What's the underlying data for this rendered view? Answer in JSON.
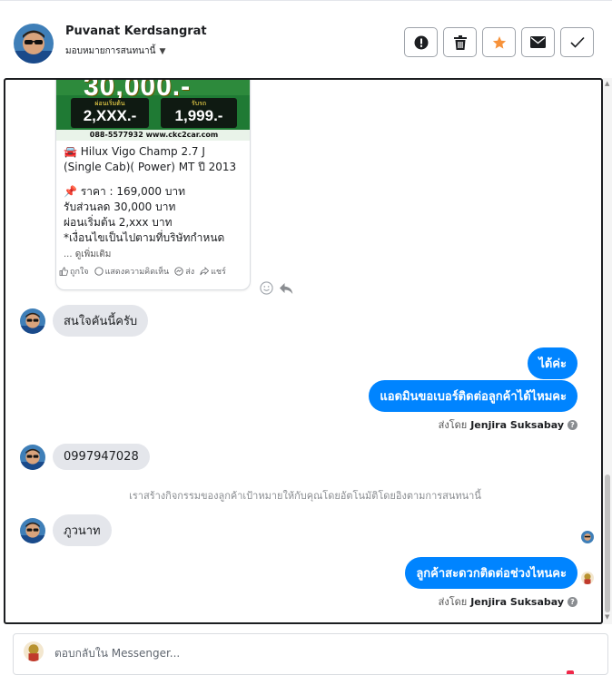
{
  "header": {
    "name": "Puvanat Kerdsangrat",
    "assign_label": "มอบหมายการสนทนานี้",
    "buttons": [
      {
        "icon": "alert-icon"
      },
      {
        "icon": "trash-icon"
      },
      {
        "icon": "star-icon",
        "color": "#f7923a"
      },
      {
        "icon": "envelope-icon"
      },
      {
        "icon": "check-icon"
      }
    ]
  },
  "post": {
    "image_text": {
      "headline": "30,000.-",
      "box1_label": "ผ่อนเริ่มต้น",
      "box1_value": "2,XXX.-",
      "box2_label": "รับรถ",
      "box2_value": "1,999.-",
      "contact": "088-5577932 www.ckc2car.com"
    },
    "title": "🚘 Hilux Vigo Champ 2.7 J (Single Cab)( Power) MT ปี 2013",
    "body": "📌 ราคา : 169,000 บาท\nรับส่วนลด 30,000 บาท\nผ่อนเริ่มต้น 2,xxx บาท\n*เงื่อนไขเป็นไปตามที่บริษัทกำหนด",
    "see_more": "... ดูเพิ่มเติม",
    "actions": {
      "like": "ถูกใจ",
      "comment": "แสดงความคิดเห็น",
      "send": "ส่ง",
      "share": "แชร์"
    }
  },
  "messages": {
    "m1": "สนใจคันนี้ครับ",
    "m2": "ได้ค่ะ",
    "m3": "แอดมินขอเบอร์ติดต่อลูกค้าได้ไหมคะ",
    "sent_by_label": "ส่งโดย",
    "sent_by_name": "Jenjira Suksabay",
    "m4": "0997947028",
    "system": "เราสร้างกิจกรรมของลูกค้าเป้าหมายให้กับคุณโดยอัตโนมัติโดยอิงตามการสนทนานี้",
    "m5": "ภูวนาท",
    "m6": "ลูกค้าสะดวกติดต่อช่วงไหนคะ"
  },
  "composer": {
    "placeholder": "ตอบกลับใน Messenger..."
  },
  "colors": {
    "outgoing_bubble": "#0084ff",
    "incoming_bubble": "#e4e6eb"
  }
}
